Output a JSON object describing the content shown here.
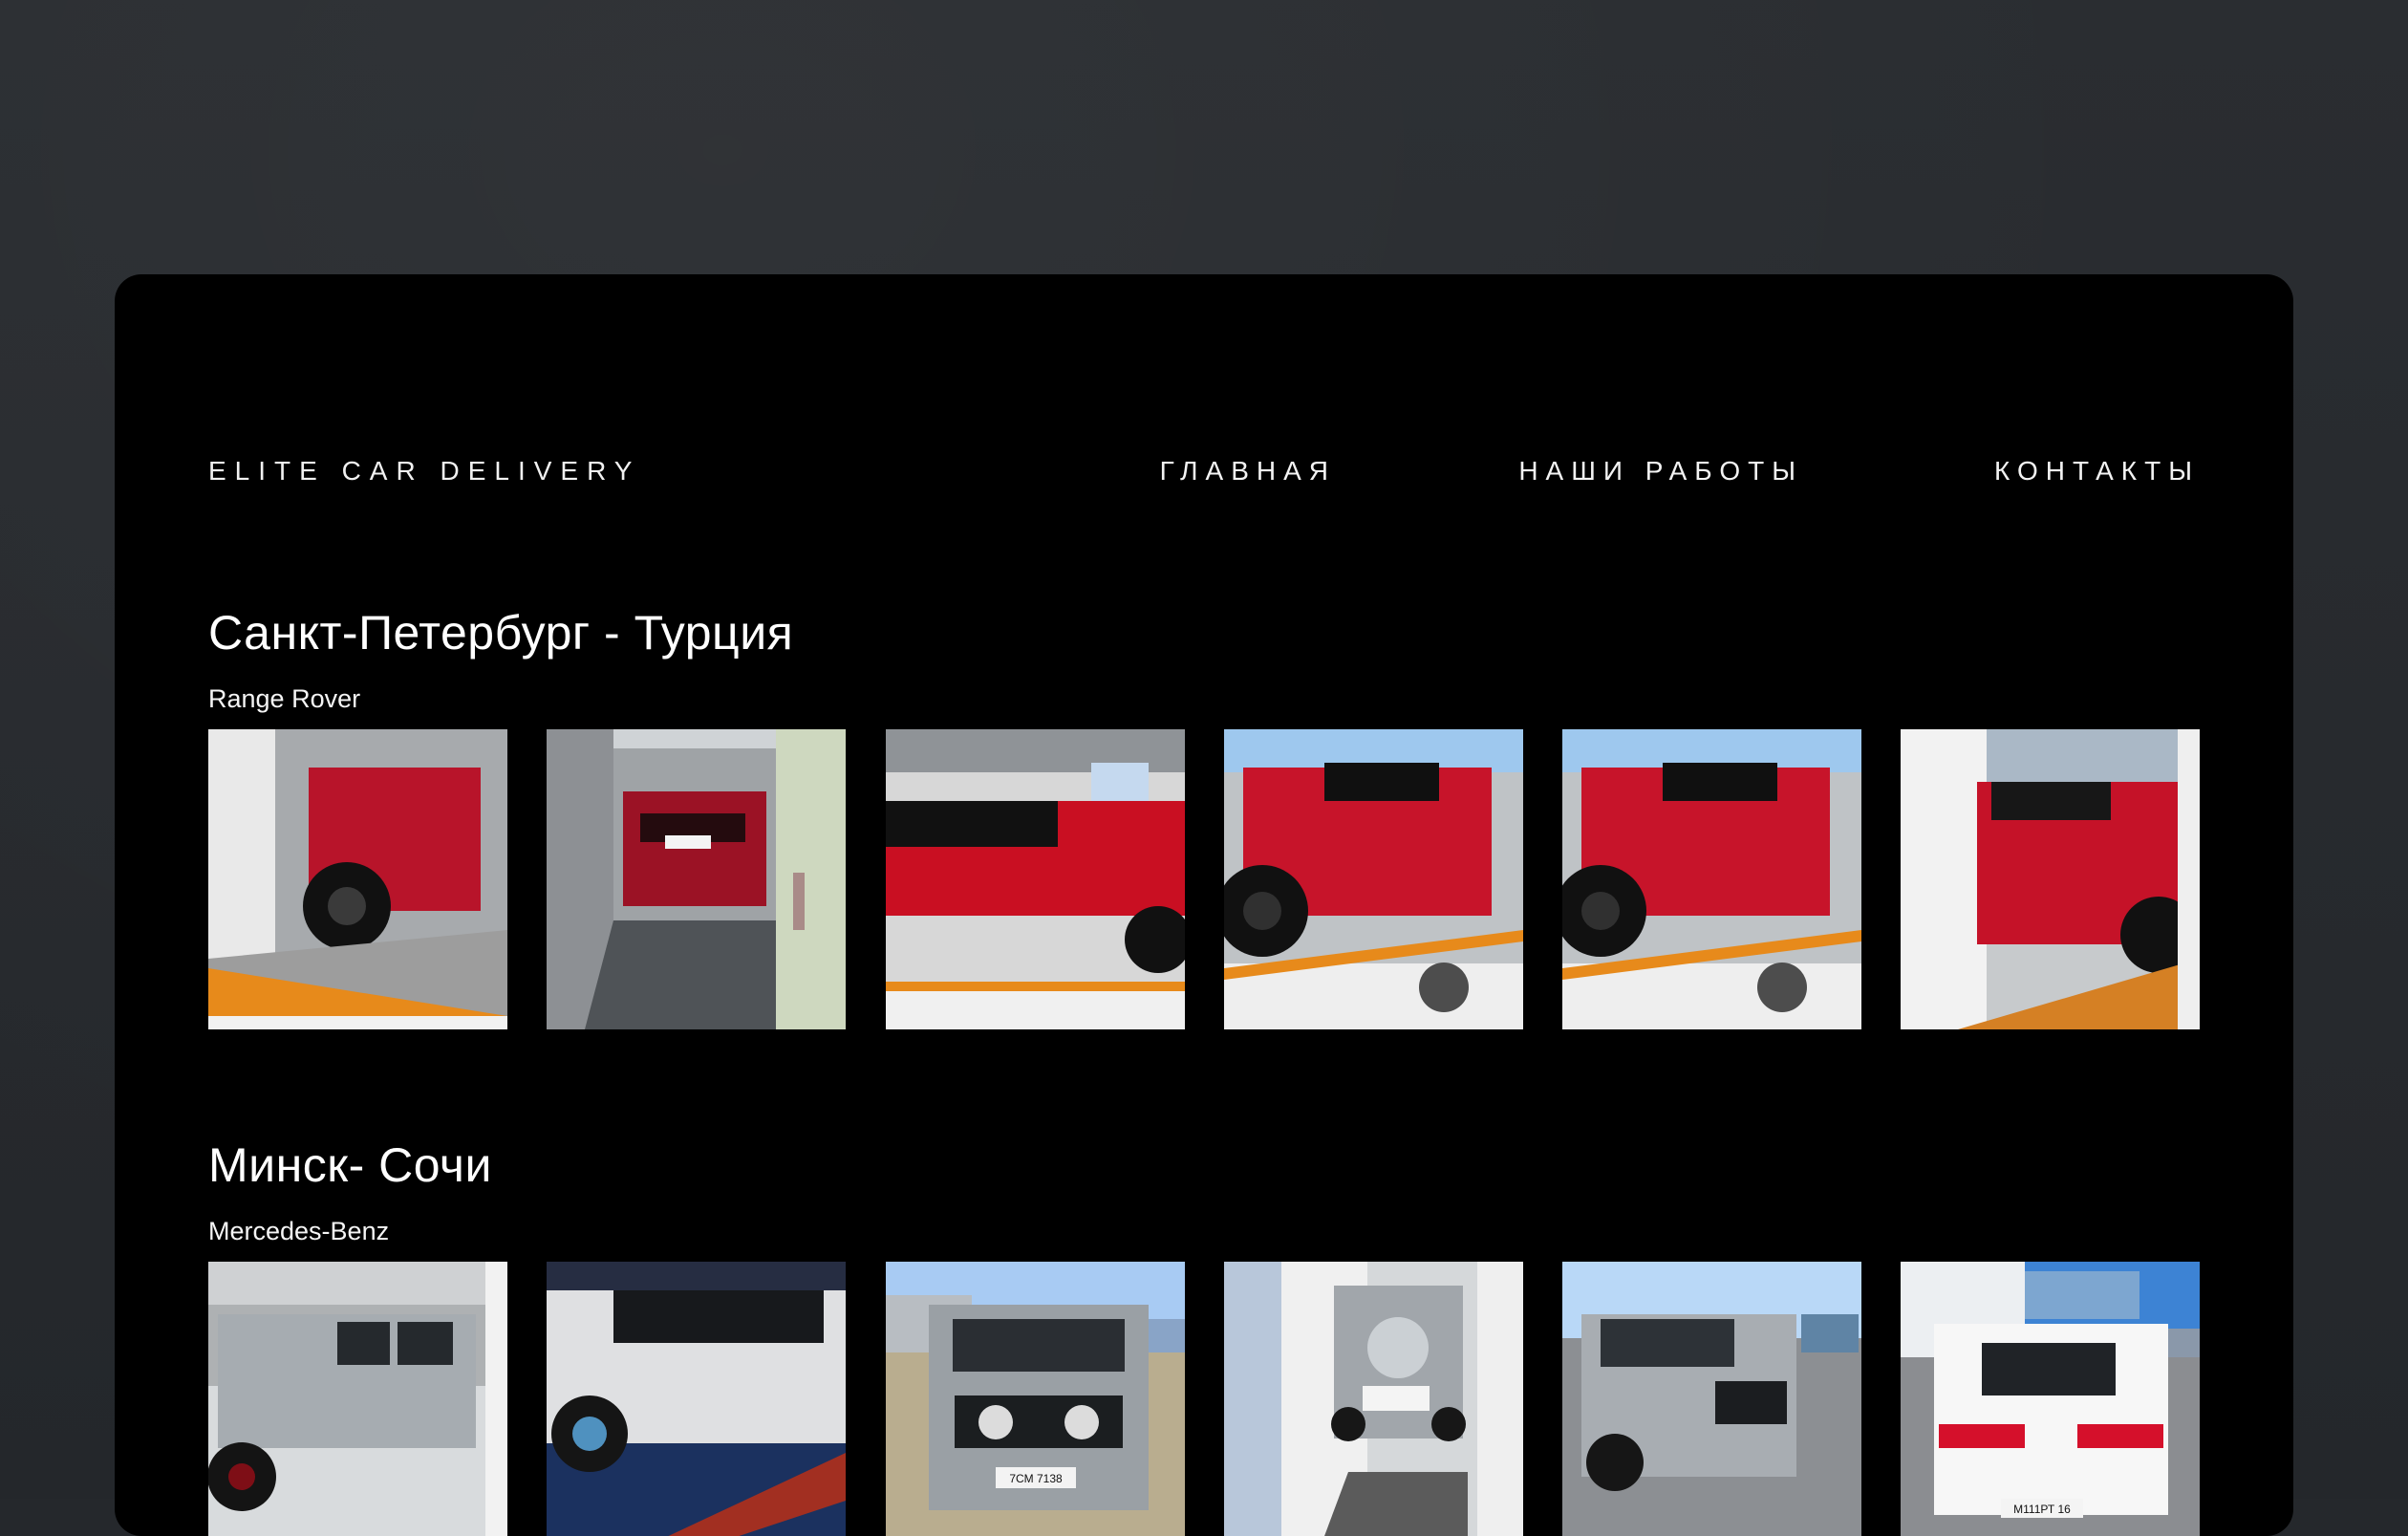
{
  "site": {
    "brand": "ELITE CAR DELIVERY",
    "nav": [
      {
        "label": "ГЛАВНАЯ"
      },
      {
        "label": "НАШИ РАБОТЫ"
      },
      {
        "label": "КОНТАКТЫ"
      }
    ]
  },
  "sections": [
    {
      "title": "Санкт-Петербург - Турция",
      "car": "Range Rover",
      "photos": [
        {
          "plate": ""
        },
        {
          "plate": ""
        },
        {
          "plate": ""
        },
        {
          "plate": ""
        },
        {
          "plate": ""
        },
        {
          "plate": ""
        }
      ]
    },
    {
      "title": "Минск- Сочи",
      "car": "Mercedes-Benz",
      "photos": [
        {
          "plate": ""
        },
        {
          "plate": ""
        },
        {
          "plate": "7CM 7138"
        },
        {
          "plate": ""
        },
        {
          "plate": ""
        },
        {
          "plate": "М111РТ 16"
        }
      ]
    }
  ],
  "colors": {
    "backdrop": "#25282c",
    "panel": "#000000",
    "text": "#f3f3f3",
    "car_red": "#b8142a",
    "car_silver": "#a8adb2",
    "truck_white": "#e8e8e8",
    "stripe_orange": "#e78a1b"
  }
}
